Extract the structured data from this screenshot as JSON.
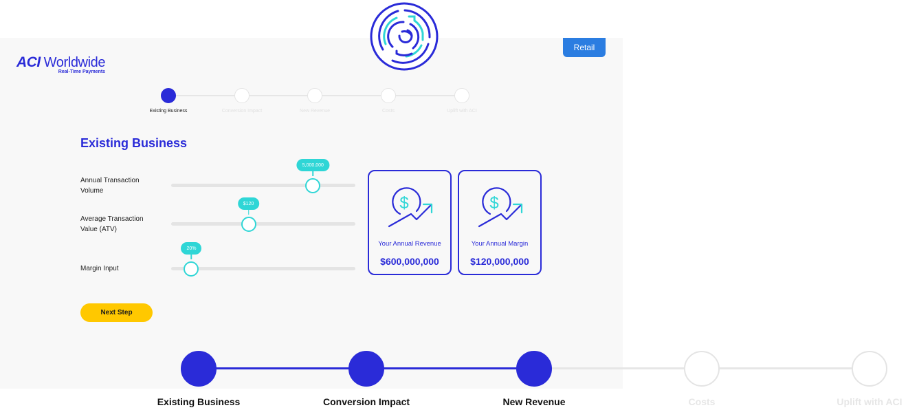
{
  "header": {
    "logo_brand": "ACI",
    "logo_name": "Worldwide",
    "logo_tagline": "Real-Time Payments",
    "segment_button": "Retail"
  },
  "mini_stepper": {
    "steps": [
      {
        "label": "Existing Business",
        "state": "active"
      },
      {
        "label": "Conversion Impact",
        "state": "pending"
      },
      {
        "label": "New Revenue",
        "state": "pending"
      },
      {
        "label": "Costs",
        "state": "pending"
      },
      {
        "label": "Uplift with ACI",
        "state": "pending"
      }
    ]
  },
  "main": {
    "title": "Existing Business",
    "sliders": [
      {
        "label": "Annual Transaction Volume",
        "value_display": "5,000,000",
        "fraction": 0.77
      },
      {
        "label": "Average Transaction Value (ATV)",
        "value_display": "$120",
        "fraction": 0.42
      },
      {
        "label": "Margin Input",
        "value_display": "20%",
        "fraction": 0.11
      }
    ],
    "cards": [
      {
        "label": "Your Annual Revenue",
        "value": "$600,000,000",
        "icon": "revenue-growth-icon"
      },
      {
        "label": "Your Annual Margin",
        "value": "$120,000,000",
        "icon": "margin-growth-icon"
      }
    ],
    "next_button": "Next Step"
  },
  "big_stepper": {
    "steps": [
      {
        "label": "Existing Business",
        "state": "done"
      },
      {
        "label": "Conversion Impact",
        "state": "done"
      },
      {
        "label": "New Revenue",
        "state": "done"
      },
      {
        "label": "Costs",
        "state": "pending"
      },
      {
        "label": "Uplift with ACI",
        "state": "pending"
      }
    ]
  },
  "colors": {
    "primary": "#2a2bd8",
    "accent": "#2fd6d6",
    "button_yellow": "#ffc800",
    "retail_blue": "#2b7de1",
    "panel_bg": "#f8f8f8",
    "inactive": "#e4e4e4"
  }
}
